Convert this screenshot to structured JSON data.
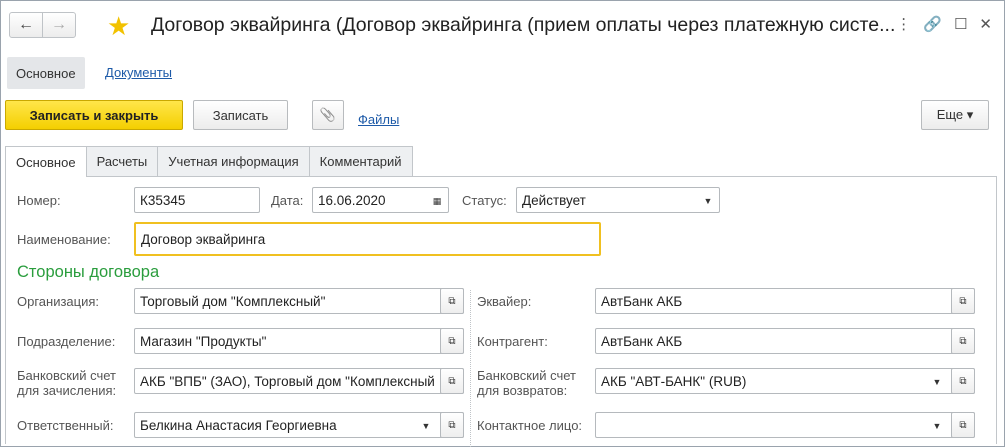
{
  "window": {
    "title": "Договор эквайринга (Договор эквайринга (прием оплаты через платежную систе...",
    "nav_back": "←",
    "nav_forward": "→",
    "favorite_icon": "star-icon",
    "more_icon": "⋮",
    "link_icon": "🔗",
    "max_icon": "☐",
    "close_icon": "✕"
  },
  "formnav": {
    "main": "Основное",
    "documents": "Документы"
  },
  "toolbar": {
    "save_close": "Записать и закрыть",
    "save": "Записать",
    "attach_icon": "📎",
    "files": "Файлы",
    "more": "Еще ▾"
  },
  "tabs": [
    {
      "label": "Основное"
    },
    {
      "label": "Расчеты"
    },
    {
      "label": "Учетная информация"
    },
    {
      "label": "Комментарий"
    }
  ],
  "form": {
    "number_label": "Номер:",
    "number_value": "К35345",
    "date_label": "Дата:",
    "date_value": "16.06.2020",
    "status_label": "Статус:",
    "status_value": "Действует",
    "name_label": "Наименование:",
    "name_value": "Договор эквайринга",
    "section_parties": "Стороны договора",
    "org_label": "Организация:",
    "org_value": "Торговый дом \"Комплексный\"",
    "dept_label": "Подразделение:",
    "dept_value": "Магазин \"Продукты\"",
    "bank_acc_label": "Банковский счет для зачисления:",
    "bank_acc_value": "АКБ \"ВПБ\" (ЗАО), Торговый дом \"Комплексный\"",
    "resp_label": "Ответственный:",
    "resp_value": "Белкина Анастасия Георгиевна",
    "acquirer_label": "Эквайер:",
    "acquirer_value": "АвтБанк АКБ",
    "counterparty_label": "Контрагент:",
    "counterparty_value": "АвтБанк АКБ",
    "return_acc_label": "Банковский счет для возвратов:",
    "return_acc_value": "АКБ \"АВТ-БАНК\" (RUB)",
    "contact_label": "Контактное лицо:",
    "contact_value": ""
  }
}
